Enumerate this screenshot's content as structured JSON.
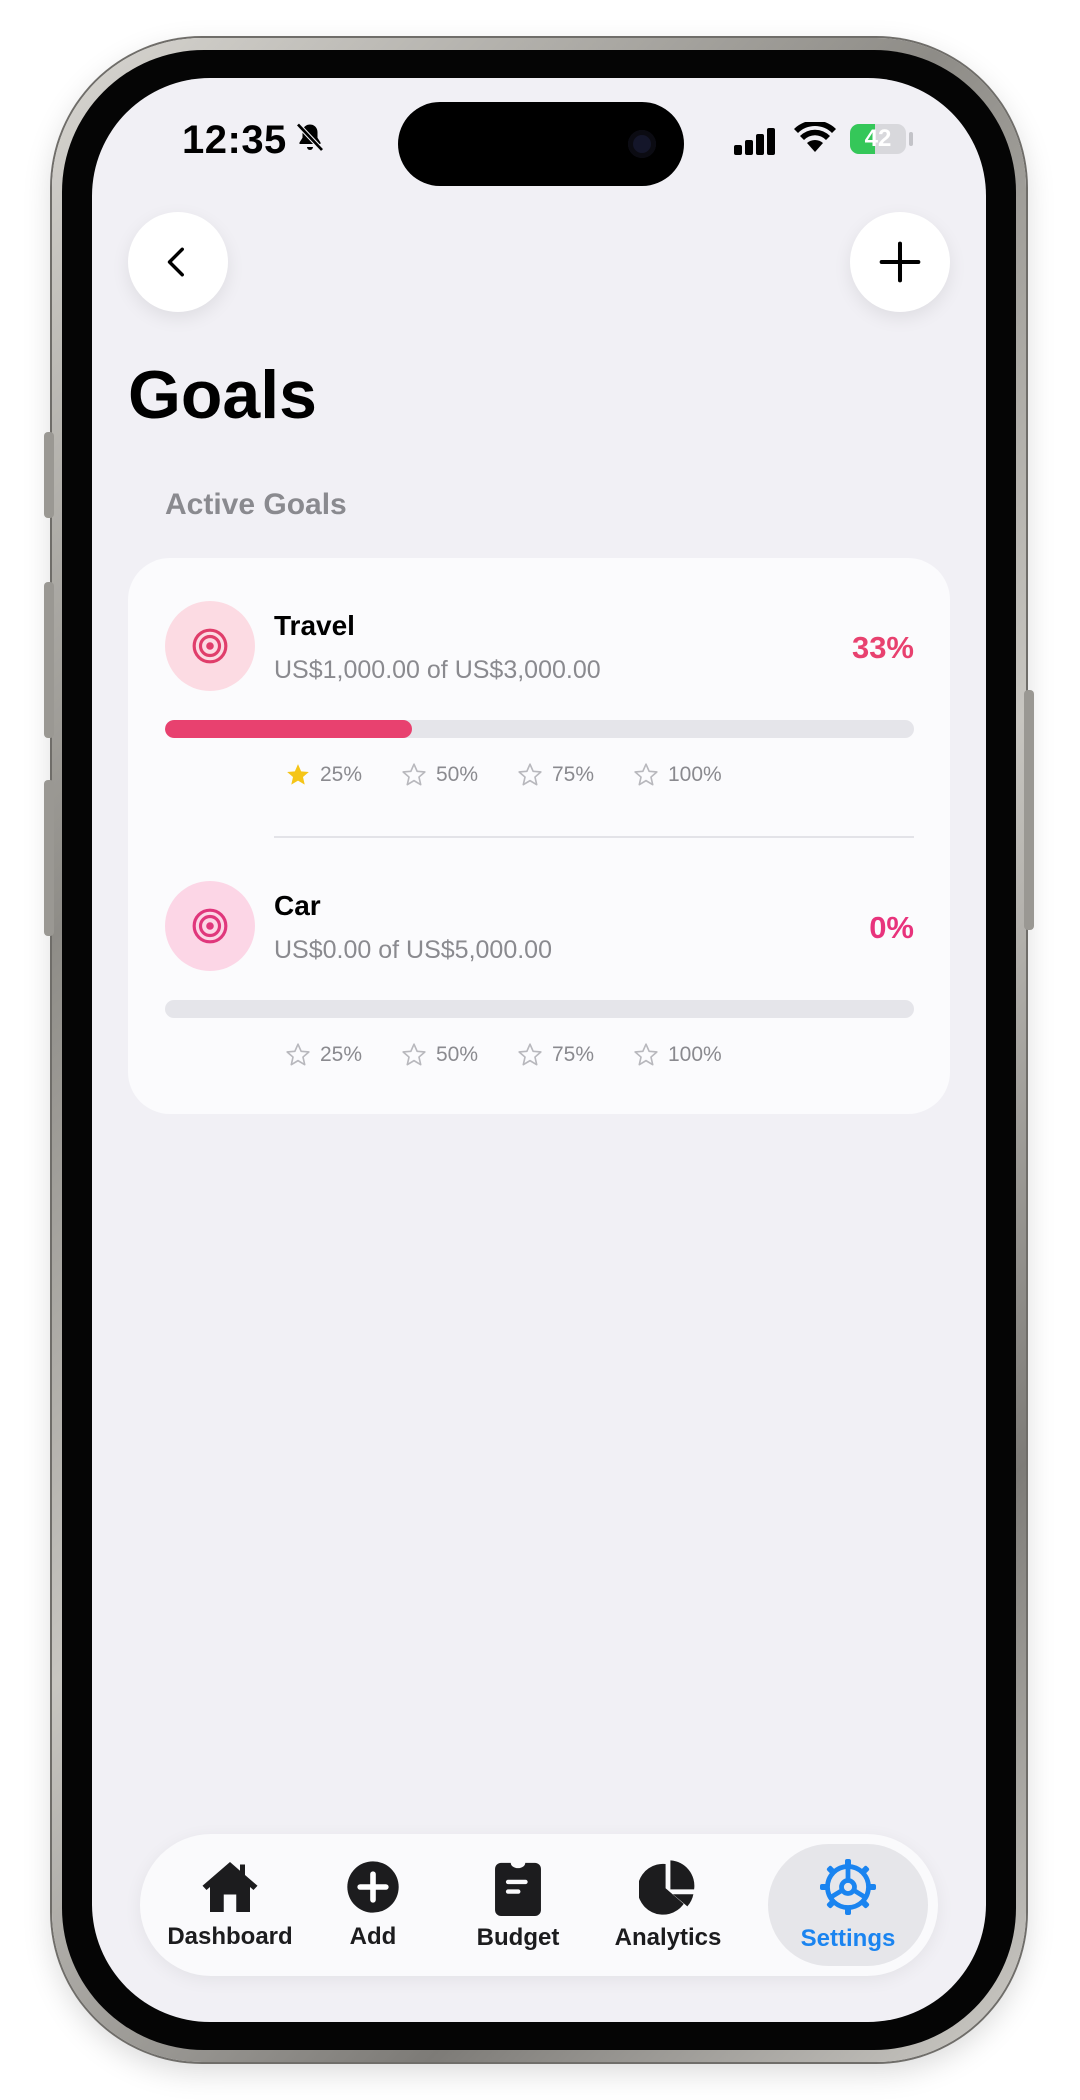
{
  "status_bar": {
    "time": "12:35",
    "battery": "42"
  },
  "header": {
    "back_icon": "chevron-left-icon",
    "add_icon": "plus-icon",
    "title": "Goals"
  },
  "section": {
    "label": "Active Goals"
  },
  "goals": [
    {
      "name": "Travel",
      "amount": "US$1,000.00 of US$3,000.00",
      "percent_label": "33%",
      "progress": 0.33,
      "percent_color": "#e8416f",
      "bar_color": "#e8416f",
      "icon": "target-icon",
      "icon_bg": "#fcdbe3",
      "icon_color": "#e03e6b",
      "milestones": [
        {
          "label": "25%",
          "reached": true
        },
        {
          "label": "50%",
          "reached": false
        },
        {
          "label": "75%",
          "reached": false
        },
        {
          "label": "100%",
          "reached": false
        }
      ]
    },
    {
      "name": "Car",
      "amount": "US$0.00 of US$5,000.00",
      "percent_label": "0%",
      "progress": 0,
      "percent_color": "#e8337c",
      "bar_color": "#e8337c",
      "icon": "target-icon",
      "icon_bg": "#fcd6e6",
      "icon_color": "#e0377c",
      "milestones": [
        {
          "label": "25%",
          "reached": false
        },
        {
          "label": "50%",
          "reached": false
        },
        {
          "label": "75%",
          "reached": false
        },
        {
          "label": "100%",
          "reached": false
        }
      ]
    }
  ],
  "colors": {
    "star_reached": "#f5c518",
    "star_unreached": "#b8b8bd",
    "tab_active": "#1a84f0"
  },
  "tabbar": {
    "tabs": [
      {
        "label": "Dashboard",
        "icon": "house-icon",
        "active": false
      },
      {
        "label": "Add",
        "icon": "plus-circle-icon",
        "active": false
      },
      {
        "label": "Budget",
        "icon": "clipboard-icon",
        "active": false
      },
      {
        "label": "Analytics",
        "icon": "pie-chart-icon",
        "active": false
      },
      {
        "label": "Settings",
        "icon": "gear-icon",
        "active": true
      }
    ]
  }
}
